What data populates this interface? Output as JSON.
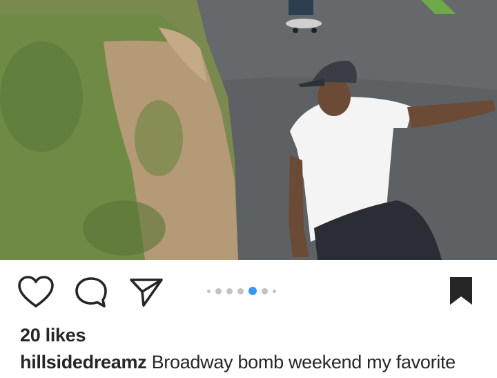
{
  "post": {
    "image": {
      "description_icon": "skatepark-photo"
    },
    "actions": {
      "like_icon": "heart-icon",
      "comment_icon": "comment-icon",
      "share_icon": "send-icon",
      "save_icon": "bookmark-icon"
    },
    "carousel": {
      "total": 7,
      "active_index": 4,
      "active_color": "#3897f0",
      "inactive_color": "#c2c2c2"
    },
    "likes": "20 likes",
    "caption": {
      "username": "hillsidedreamz",
      "text": "Broadway bomb weekend my favorite"
    }
  }
}
